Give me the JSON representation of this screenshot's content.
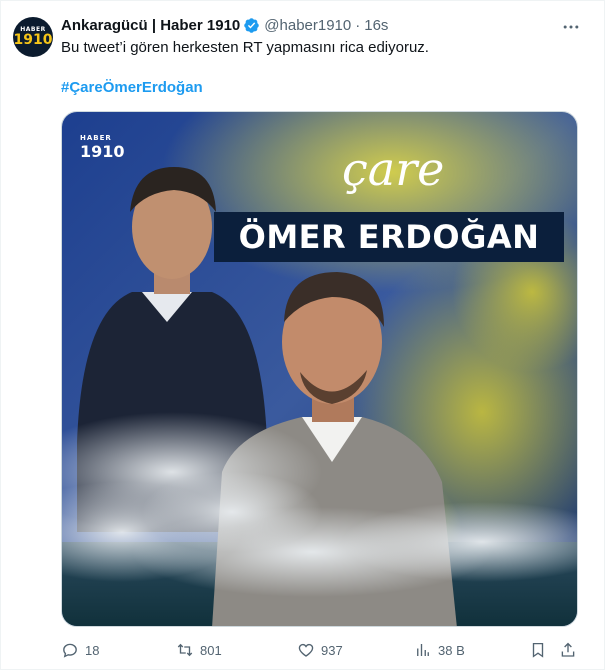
{
  "tweet": {
    "author_name": "Ankaragücü | Haber 1910",
    "handle": "@haber1910",
    "separator": "·",
    "time": "16s",
    "text": "Bu tweet’i gören herkesten RT yapmasını rica ediyoruz.",
    "hashtag": "#ÇareÖmerErdoğan"
  },
  "avatar": {
    "line1": "HABER",
    "line2": "1910"
  },
  "media": {
    "logo_line1": "HABER",
    "logo_line2": "1910",
    "headline_script": "çare",
    "headline_name": "ÖMER ERDOĞAN"
  },
  "actions": {
    "replies": "18",
    "retweets": "801",
    "likes": "937",
    "views": "38 B"
  },
  "icons": [
    "more-icon",
    "verified-icon",
    "reply-icon",
    "retweet-icon",
    "like-icon",
    "views-icon",
    "bookmark-icon",
    "share-icon"
  ],
  "colors": {
    "link": "#1d9bf0",
    "secondary": "#536471",
    "verified": "#1d9bf0"
  }
}
